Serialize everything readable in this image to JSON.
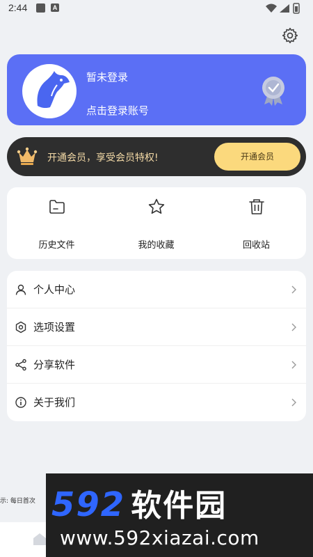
{
  "status_bar": {
    "time": "2:44",
    "icon2_letter": "A"
  },
  "login_card": {
    "title": "暂未登录",
    "subtitle": "点击登录账号"
  },
  "vip": {
    "text": "开通会员，享受会员特权!",
    "button": "开通会员"
  },
  "quick_actions": [
    {
      "label": "历史文件",
      "icon": "folder-icon"
    },
    {
      "label": "我的收藏",
      "icon": "star-icon"
    },
    {
      "label": "回收站",
      "icon": "trash-icon"
    }
  ],
  "menu": [
    {
      "label": "个人中心",
      "icon": "person-icon"
    },
    {
      "label": "选项设置",
      "icon": "settings-icon"
    },
    {
      "label": "分享软件",
      "icon": "share-icon"
    },
    {
      "label": "关于我们",
      "icon": "info-icon"
    }
  ],
  "ticker": "示: 每日首次",
  "watermark": {
    "brand_num": "592",
    "brand_cn": "软件园",
    "url": "www.592xiazai.com"
  },
  "colors": {
    "accent": "#5b6ff5",
    "vip_bg": "#2e2e2e",
    "vip_button": "#fbd97d",
    "page_bg": "#eff1f4"
  }
}
